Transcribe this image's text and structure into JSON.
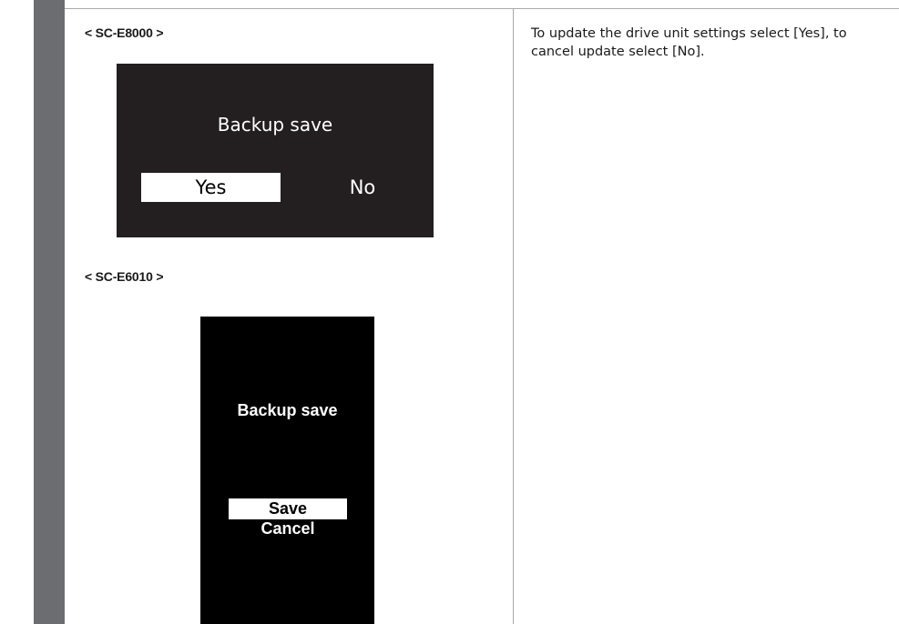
{
  "section_e8000": {
    "label": "< SC-E8000 >",
    "screen": {
      "title": "Backup save",
      "options": [
        "Yes",
        "No"
      ],
      "selected": "Yes"
    }
  },
  "section_e6010": {
    "label": "< SC-E6010 >",
    "screen": {
      "title": "Backup save",
      "options": [
        "Save",
        "Cancel"
      ],
      "selected": "Save"
    }
  },
  "description": "To update the drive unit settings select [Yes], to cancel update select [No].",
  "colors": {
    "sidebar": "#6c6d70",
    "rule": "#a9a9ab",
    "screen_e8000_bg": "#231f20",
    "screen_e6010_bg": "#000000",
    "highlight": "#ffffff"
  }
}
